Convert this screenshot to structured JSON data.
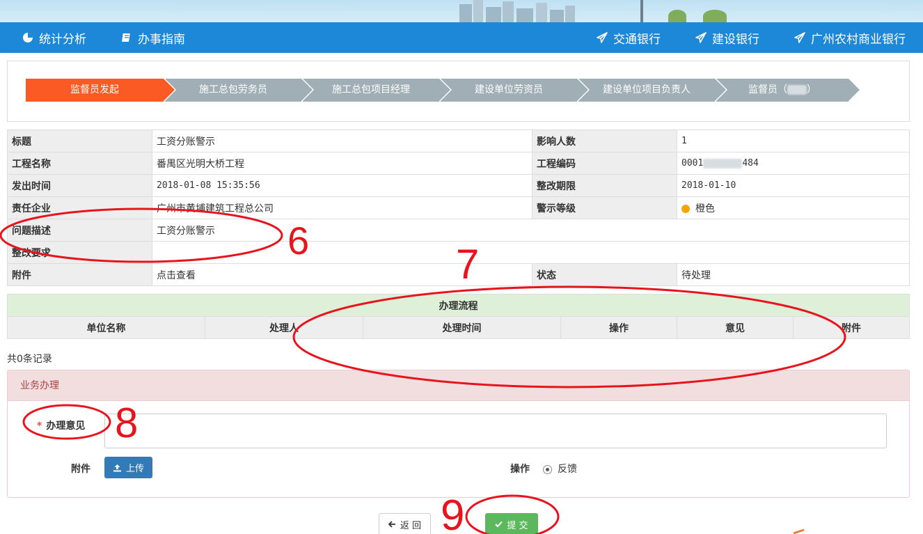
{
  "nav": {
    "left": [
      {
        "label": "统计分析",
        "icon": "chart-pie-icon"
      },
      {
        "label": "办事指南",
        "icon": "book-icon"
      }
    ],
    "right": [
      {
        "label": "交通银行",
        "icon": "send-icon"
      },
      {
        "label": "建设银行",
        "icon": "send-icon"
      },
      {
        "label": "广州农村商业银行",
        "icon": "send-icon"
      }
    ]
  },
  "steps": [
    {
      "label": "监督员发起",
      "state": "active"
    },
    {
      "label": "施工总包劳务员",
      "state": "pending"
    },
    {
      "label": "施工总包项目经理",
      "state": "pending"
    },
    {
      "label": "建设单位劳资员",
      "state": "pending"
    },
    {
      "label": "建设单位项目负责人",
      "state": "pending"
    },
    {
      "label_prefix": "监督员（",
      "label_suffix": "）",
      "state": "pending"
    }
  ],
  "info": {
    "title_label": "标题",
    "title_value": "工资分账警示",
    "affected_label": "影响人数",
    "affected_value": "1",
    "project_name_label": "工程名称",
    "project_name_value": "番禺区光明大桥工程",
    "project_code_label": "工程编码",
    "project_code_prefix": "0001",
    "project_code_suffix": "484",
    "issued_label": "发出时间",
    "issued_value": "2018-01-08 15:35:56",
    "deadline_label": "整改期限",
    "deadline_value": "2018-01-10",
    "company_label": "责任企业",
    "company_value": "广州市黄埔建筑工程总公司",
    "level_label": "警示等级",
    "level_value": "橙色",
    "level_color": "#f5a300",
    "problem_label": "问题描述",
    "problem_value": "工资分账警示",
    "requirement_label": "整改要求",
    "requirement_value": "",
    "attachment_label": "附件",
    "attachment_value": "点击查看",
    "status_label": "状态",
    "status_value": "待处理"
  },
  "process": {
    "title": "办理流程",
    "columns": [
      "单位名称",
      "处理人",
      "处理时间",
      "操作",
      "意见",
      "附件"
    ],
    "records_text": "共0条记录"
  },
  "business": {
    "panel_title": "业务办理",
    "opinion_required_mark": "*",
    "opinion_label": "办理意见",
    "attachment_label": "附件",
    "upload_label": "上传",
    "operation_label": "操作",
    "operation_option": "反馈"
  },
  "buttons": {
    "back_label": "返 回",
    "submit_label": "提 交"
  },
  "annotations": {
    "numbers": [
      "6",
      "7",
      "8",
      "9"
    ],
    "color": "#e8141d"
  }
}
